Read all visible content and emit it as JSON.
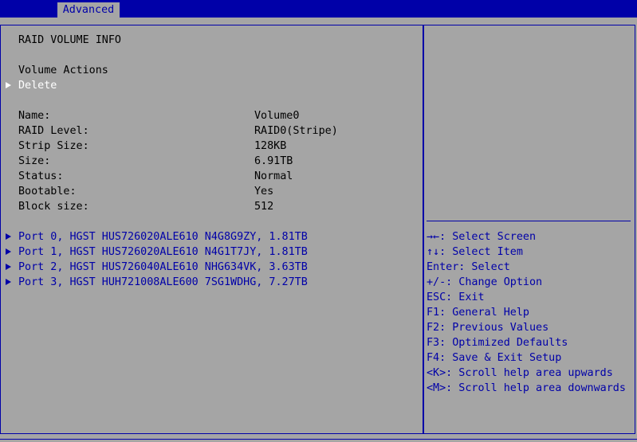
{
  "tabs": {
    "active": "Advanced"
  },
  "main": {
    "title": "RAID VOLUME INFO",
    "actions_label": "Volume Actions",
    "delete_label": "Delete",
    "properties": [
      {
        "label": "Name:",
        "value": "Volume0"
      },
      {
        "label": "RAID Level:",
        "value": "RAID0(Stripe)"
      },
      {
        "label": "Strip Size:",
        "value": "128KB"
      },
      {
        "label": "Size:",
        "value": "6.91TB"
      },
      {
        "label": "Status:",
        "value": "Normal"
      },
      {
        "label": "Bootable:",
        "value": "Yes"
      },
      {
        "label": "Block size:",
        "value": "512"
      }
    ],
    "ports": [
      "Port 0, HGST HUS726020ALE610 N4G8G9ZY, 1.81TB",
      "Port 1, HGST HUS726020ALE610 N4G1T7JY, 1.81TB",
      "Port 2, HGST HUS726040ALE610 NHG634VK, 3.63TB",
      "Port 3, HGST HUH721008ALE600 7SG1WDHG, 7.27TB"
    ]
  },
  "help": {
    "items": [
      "→←: Select Screen",
      "↑↓: Select Item",
      "Enter: Select",
      "+/-: Change Option",
      "ESC: Exit",
      "F1: General Help",
      "F2: Previous Values",
      "F3: Optimized Defaults",
      "F4: Save & Exit Setup",
      "<K>: Scroll help area upwards",
      "<M>: Scroll help area downwards"
    ]
  },
  "colors": {
    "background": "#a5a5a5",
    "accent_blue": "#0000a8",
    "highlight": "#ffffff",
    "text": "#000000"
  }
}
